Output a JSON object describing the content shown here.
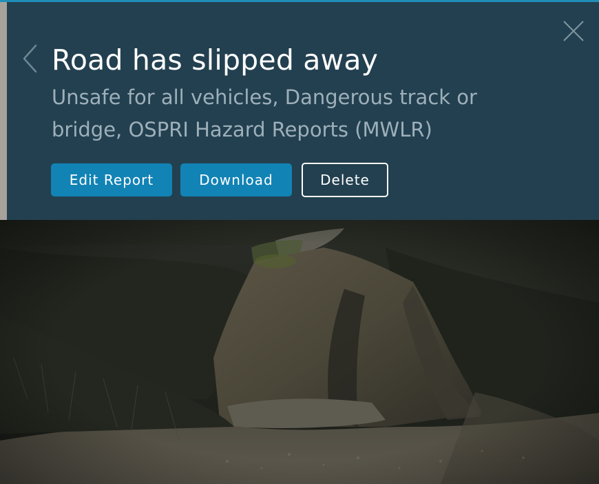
{
  "report": {
    "title": "Road has slipped away",
    "subtitle": "Unsafe for all vehicles, Dangerous track or bridge, OSPRI Hazard Reports (MWLR)"
  },
  "actions": {
    "edit_label": "Edit Report",
    "download_label": "Download",
    "delete_label": "Delete"
  },
  "navigation": {
    "back_icon": "chevron-left-icon",
    "close_icon": "close-icon"
  },
  "colors": {
    "accent": "#1f8fb8",
    "panel": "#234050",
    "button_primary": "#1283b5",
    "title": "#ffffff",
    "subtitle": "#9eb0ba"
  }
}
